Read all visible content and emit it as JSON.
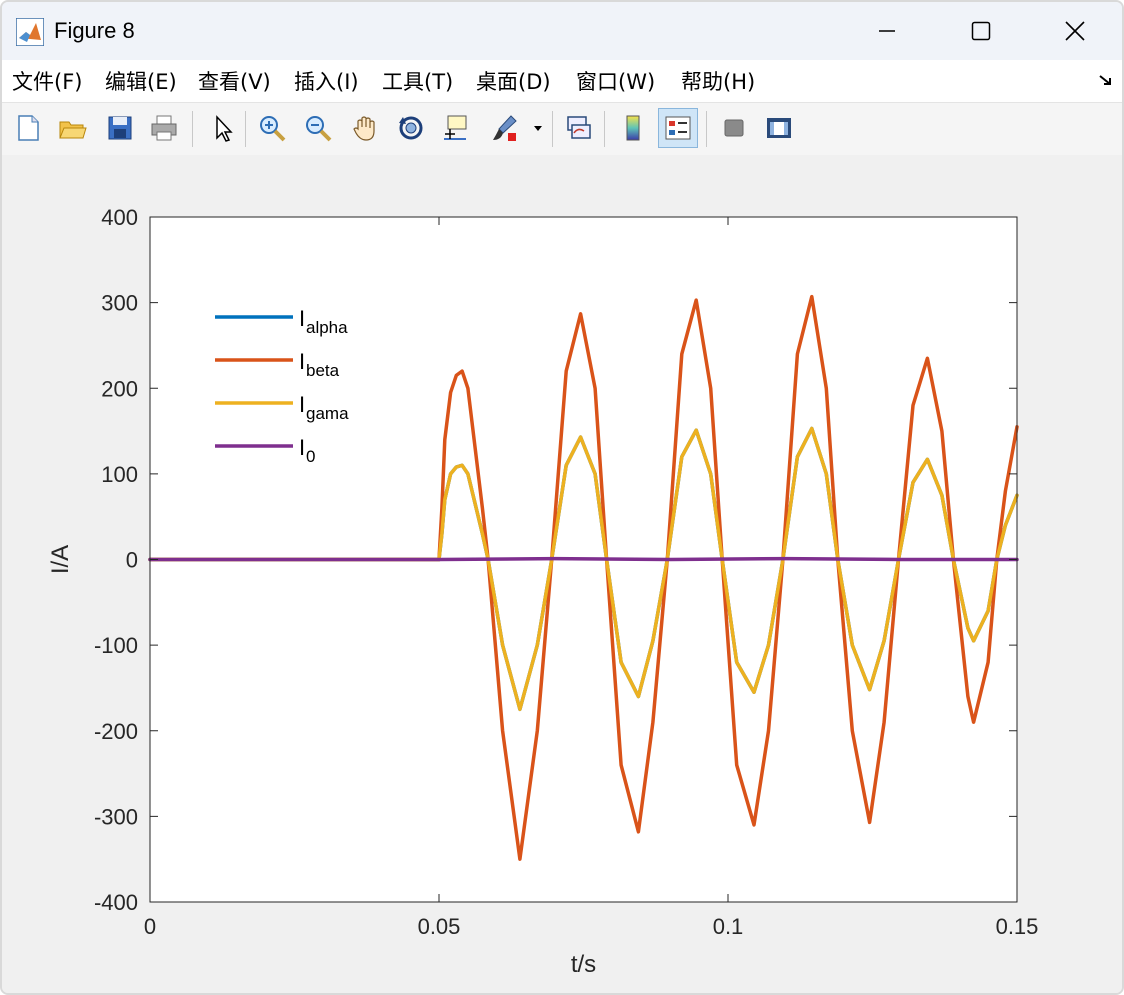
{
  "window": {
    "title": "Figure 8",
    "minimize_label": "—",
    "maximize_label": "☐",
    "close_label": "✕"
  },
  "menu": {
    "items": [
      {
        "label": "文件(F)"
      },
      {
        "label": "编辑(E)"
      },
      {
        "label": "查看(V)"
      },
      {
        "label": "插入(I)"
      },
      {
        "label": "工具(T)"
      },
      {
        "label": "桌面(D)"
      },
      {
        "label": "窗口(W)"
      },
      {
        "label": "帮助(H)"
      }
    ]
  },
  "toolbar": {
    "icons": [
      "new-figure-icon",
      "open-icon",
      "save-icon",
      "print-icon",
      "pointer-icon",
      "zoom-in-icon",
      "zoom-out-icon",
      "pan-icon",
      "rotate-icon",
      "data-cursor-icon",
      "brush-icon",
      "dropdown-arrow-icon",
      "link-plot-icon",
      "colorbar-icon",
      "legend-icon",
      "hide-plot-tools-icon",
      "show-plot-tools-icon"
    ]
  },
  "colors": {
    "alpha": "#0072BD",
    "beta": "#D95319",
    "gama": "#EDB120",
    "zero": "#7E2F8E"
  },
  "chart_data": {
    "type": "line",
    "xlabel": "t/s",
    "ylabel": "I/A",
    "xlim": [
      0,
      0.15
    ],
    "ylim": [
      -400,
      400
    ],
    "xticks": [
      0,
      0.05,
      0.1,
      0.15
    ],
    "xtick_labels": [
      "0",
      "0.05",
      "0.1",
      "0.15"
    ],
    "yticks": [
      -400,
      -300,
      -200,
      -100,
      0,
      100,
      200,
      300,
      400
    ],
    "ytick_labels": [
      "-400",
      "-300",
      "-200",
      "-100",
      "0",
      "100",
      "200",
      "300",
      "400"
    ],
    "grid": false,
    "legend_position": "top-left",
    "legend": [
      {
        "main": "I",
        "sub": "alpha"
      },
      {
        "main": "I",
        "sub": "beta"
      },
      {
        "main": "I",
        "sub": "gama"
      },
      {
        "main": "I",
        "sub": "0"
      }
    ],
    "series": [
      {
        "name": "Ialpha",
        "x": [
          0,
          0.05,
          0.0505,
          0.051,
          0.052,
          0.053,
          0.054,
          0.055,
          0.0575,
          0.0585,
          0.061,
          0.064,
          0.067,
          0.0695,
          0.072,
          0.0745,
          0.077,
          0.079,
          0.0815,
          0.0845,
          0.087,
          0.0895,
          0.092,
          0.0945,
          0.097,
          0.099,
          0.1015,
          0.1045,
          0.107,
          0.1095,
          0.112,
          0.1145,
          0.117,
          0.119,
          0.1215,
          0.1245,
          0.127,
          0.1295,
          0.132,
          0.1345,
          0.137,
          0.139,
          0.1415,
          0.1425,
          0.145,
          0.1465,
          0.148,
          0.15
        ],
        "y": [
          0,
          0,
          30,
          70,
          100,
          108,
          110,
          100,
          30,
          0,
          -100,
          -175,
          -100,
          0,
          110,
          143,
          100,
          0,
          -120,
          -160,
          -95,
          0,
          120,
          151,
          100,
          0,
          -120,
          -155,
          -100,
          0,
          120,
          153,
          100,
          0,
          -100,
          -152,
          -95,
          0,
          90,
          117,
          75,
          0,
          -80,
          -95,
          -60,
          0,
          40,
          75
        ]
      },
      {
        "name": "Ibeta",
        "x": [
          0,
          0.05,
          0.0505,
          0.051,
          0.052,
          0.053,
          0.054,
          0.055,
          0.0575,
          0.0585,
          0.061,
          0.064,
          0.067,
          0.0695,
          0.072,
          0.0745,
          0.077,
          0.079,
          0.0815,
          0.0845,
          0.087,
          0.0895,
          0.092,
          0.0945,
          0.097,
          0.099,
          0.1015,
          0.1045,
          0.107,
          0.1095,
          0.112,
          0.1145,
          0.117,
          0.119,
          0.1215,
          0.1245,
          0.127,
          0.1295,
          0.132,
          0.1345,
          0.137,
          0.139,
          0.1415,
          0.1425,
          0.145,
          0.1465,
          0.148,
          0.15
        ],
        "y": [
          0,
          0,
          60,
          140,
          195,
          215,
          220,
          200,
          60,
          0,
          -200,
          -350,
          -200,
          0,
          220,
          287,
          200,
          0,
          -240,
          -318,
          -190,
          0,
          240,
          303,
          200,
          0,
          -240,
          -310,
          -200,
          0,
          240,
          307,
          200,
          0,
          -200,
          -307,
          -190,
          0,
          180,
          235,
          150,
          0,
          -160,
          -190,
          -120,
          0,
          80,
          155
        ]
      },
      {
        "name": "Igama",
        "x": [
          0,
          0.05,
          0.0505,
          0.051,
          0.052,
          0.053,
          0.054,
          0.055,
          0.0575,
          0.0585,
          0.061,
          0.064,
          0.067,
          0.0695,
          0.072,
          0.0745,
          0.077,
          0.079,
          0.0815,
          0.0845,
          0.087,
          0.0895,
          0.092,
          0.0945,
          0.097,
          0.099,
          0.1015,
          0.1045,
          0.107,
          0.1095,
          0.112,
          0.1145,
          0.117,
          0.119,
          0.1215,
          0.1245,
          0.127,
          0.1295,
          0.132,
          0.1345,
          0.137,
          0.139,
          0.1415,
          0.1425,
          0.145,
          0.1465,
          0.148,
          0.15
        ],
        "y": [
          0,
          0,
          30,
          70,
          100,
          108,
          110,
          100,
          30,
          0,
          -100,
          -175,
          -100,
          0,
          110,
          143,
          100,
          0,
          -120,
          -160,
          -95,
          0,
          120,
          151,
          100,
          0,
          -120,
          -155,
          -100,
          0,
          120,
          153,
          100,
          0,
          -100,
          -152,
          -95,
          0,
          90,
          117,
          75,
          0,
          -80,
          -95,
          -60,
          0,
          40,
          75
        ]
      },
      {
        "name": "I0",
        "x": [
          0,
          0.05,
          0.07,
          0.09,
          0.11,
          0.13,
          0.15
        ],
        "y": [
          0,
          0,
          1,
          0,
          1,
          0,
          0
        ]
      }
    ]
  }
}
